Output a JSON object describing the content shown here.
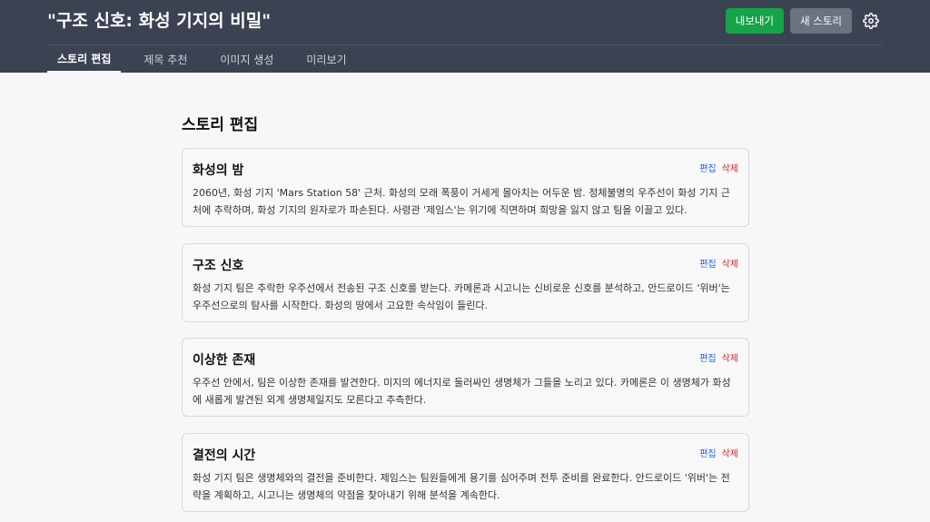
{
  "header": {
    "title": "\"구조 신호: 화성 기지의 비밀\"",
    "export_label": "내보내기",
    "new_story_label": "새 스토리",
    "settings_icon": "gear-icon"
  },
  "tabs": [
    {
      "label": "스토리 편집",
      "active": true
    },
    {
      "label": "제목 추천",
      "active": false
    },
    {
      "label": "이미지 생성",
      "active": false
    },
    {
      "label": "미리보기",
      "active": false
    }
  ],
  "main": {
    "heading": "스토리 편집",
    "edit_label": "편집",
    "delete_label": "삭제",
    "scenes": [
      {
        "title": "화성의 밤",
        "body": "2060년, 화성 기지 'Mars Station 58' 근처. 화성의 모래 폭풍이 거세게 몰아치는 어두운 밤. 정체불명의 우주선이 화성 기지 근처에 추락하며, 화성 기지의 원자로가 파손된다. 사령관 '제임스'는 위기에 직면하며 희망을 잃지 않고 팀을 이끌고 있다."
      },
      {
        "title": "구조 신호",
        "body": "화성 기지 팀은 추락한 우주선에서 전송된 구조 신호를 받는다. 카메론과 시고니는 신비로운 신호를 분석하고, 안드로이드 '위버'는 우주선으로의 탐사를 시작한다. 화성의 땅에서 고요한 속삭임이 들린다."
      },
      {
        "title": "이상한 존재",
        "body": "우주선 안에서, 팀은 이상한 존재를 발견한다. 미지의 에너지로 둘러싸인 생명체가 그들을 노리고 있다. 카메론은 이 생명체가 화성에 새롭게 발견된 외계 생명체일지도 모른다고 추측한다."
      },
      {
        "title": "결전의 시간",
        "body": "화성 기지 팀은 생명체와의 결전을 준비한다. 제임스는 팀원들에게 용기를 심어주며 전투 준비를 완료한다. 안드로이드 '위버'는 전략을 계획하고, 시고니는 생명체의 약점을 찾아내기 위해 분석을 계속한다."
      }
    ]
  },
  "colors": {
    "header_bg": "#3b4252",
    "export_button": "#16a34a",
    "new_story_button": "#6b7280",
    "edit_link": "#2563eb",
    "delete_link": "#dc2626"
  }
}
